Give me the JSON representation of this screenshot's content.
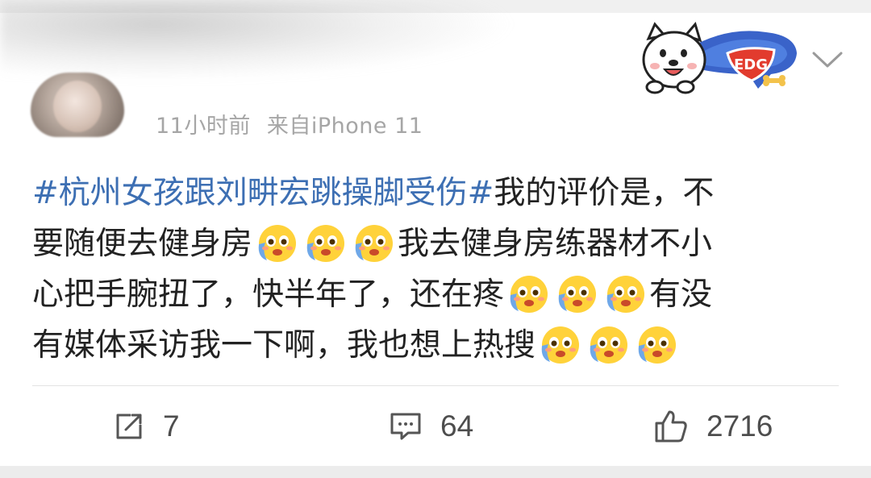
{
  "post": {
    "time": "11小时前",
    "source": "来自iPhone 11"
  },
  "content": {
    "topic": "#杭州女孩跟刘畊宏跳操脚受伤#",
    "line1_rest": "我的评价是，不",
    "line2_text": "要随便去健身房",
    "line2_after": "我去健身房练器材不小",
    "line3_text": "心把手腕扭了，快半年了，还在疼",
    "line3_after": "有没",
    "line4_text": "有媒体采访我一下啊，我也想上热搜"
  },
  "badge": {
    "text": "EDG"
  },
  "actions": {
    "repost_count": "7",
    "comment_count": "64",
    "like_count": "2716"
  },
  "colors": {
    "topic": "#3d6fb3",
    "meta": "#a6a6a6",
    "text": "#222222"
  },
  "icons": [
    "chevron-down-icon",
    "repost-icon",
    "comment-icon",
    "like-icon",
    "crying-emoji-icon",
    "dog-mascot-badge"
  ]
}
